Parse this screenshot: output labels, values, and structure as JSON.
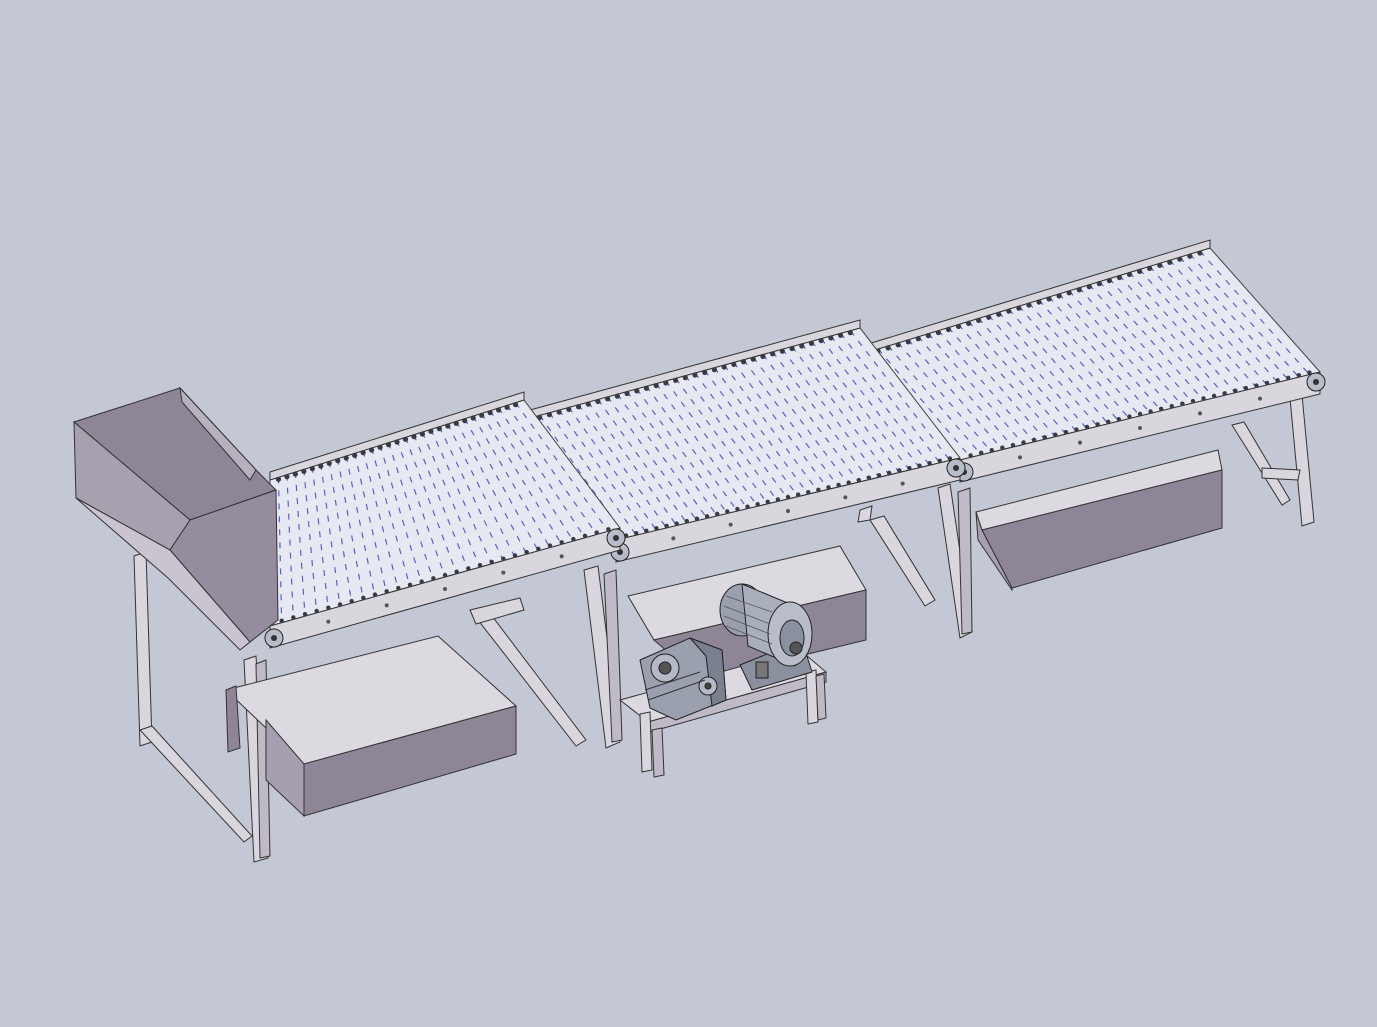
{
  "scene": {
    "background": "#c4c8d4",
    "frame_color": "#d9d6de",
    "frame_shadow": "#8f8b99",
    "tray_color": "#8e8596",
    "tray_light": "#ddd9e1",
    "roller_color": "#3340c0",
    "chain_color": "#3a3a44",
    "motor_color": "#9aa0ae",
    "components": [
      "hopper-icon",
      "conveyor-section-1",
      "conveyor-section-2",
      "conveyor-section-3",
      "collection-tray-1",
      "collection-tray-2",
      "collection-tray-3",
      "gear-reducer-icon",
      "electric-motor-icon",
      "motor-stand"
    ]
  }
}
